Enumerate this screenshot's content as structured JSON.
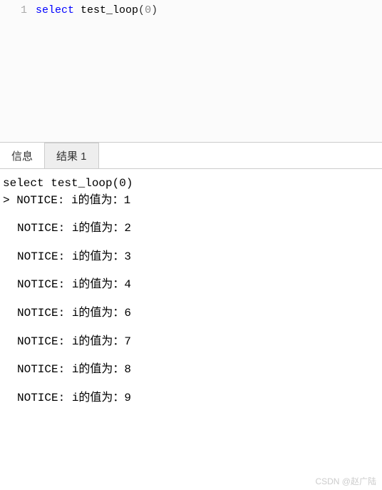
{
  "editor": {
    "line_number": "1",
    "keyword": "select",
    "space1": " ",
    "fn": "test_loop",
    "paren_open": "(",
    "arg": "0",
    "paren_close": ")"
  },
  "tabs": {
    "info": "信息",
    "result": "结果 1"
  },
  "output": {
    "query": "select test_loop(0)",
    "first": "> NOTICE:  i的值为：1",
    "lines": [
      "NOTICE:  i的值为：2",
      "NOTICE:  i的值为：3",
      "NOTICE:  i的值为：4",
      "NOTICE:  i的值为：6",
      "NOTICE:  i的值为：7",
      "NOTICE:  i的值为：8",
      "NOTICE:  i的值为：9"
    ]
  },
  "watermark": "CSDN @赵广陆"
}
